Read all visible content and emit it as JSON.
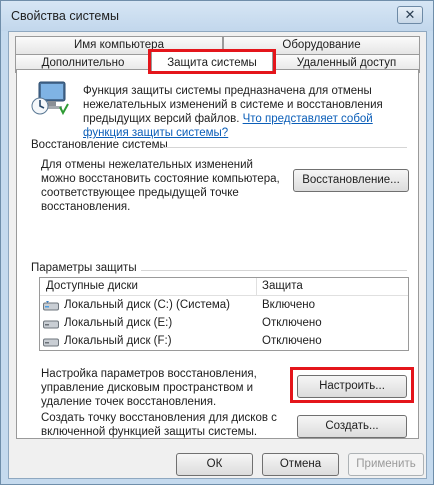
{
  "window": {
    "title": "Свойства системы",
    "close_label": "✕"
  },
  "tabs": {
    "row1": [
      {
        "label": "Имя компьютера"
      },
      {
        "label": "Оборудование"
      }
    ],
    "row2": [
      {
        "label": "Дополнительно"
      },
      {
        "label": "Защита системы",
        "active": true
      },
      {
        "label": "Удаленный доступ"
      }
    ]
  },
  "intro": {
    "text": "Функция защиты системы предназначена для отмены нежелательных изменений в системе и восстановления предыдущих версий файлов. ",
    "link": "Что представляет собой функция защиты системы?"
  },
  "restore_group": {
    "label": "Восстановление системы",
    "text": "Для отмены нежелательных изменений можно восстановить состояние компьютера, соответствующее предыдущей точке восстановления.",
    "button": "Восстановление..."
  },
  "protection_group": {
    "label": "Параметры защиты",
    "columns": {
      "drives": "Доступные диски",
      "protection": "Защита"
    },
    "rows": [
      {
        "name": "Локальный диск (C:) (Система)",
        "status": "Включено"
      },
      {
        "name": "Локальный диск (E:)",
        "status": "Отключено"
      },
      {
        "name": "Локальный диск (F:)",
        "status": "Отключено"
      }
    ],
    "configure_text": "Настройка параметров восстановления, управление дисковым пространством и удаление точек восстановления.",
    "configure_button": "Настроить...",
    "create_text": "Создать точку восстановления для дисков с включенной функцией защиты системы.",
    "create_button": "Создать..."
  },
  "footer": {
    "ok": "ОК",
    "cancel": "Отмена",
    "apply": "Применить"
  },
  "colors": {
    "highlight": "#e4151b",
    "link": "#0b5eb8"
  }
}
